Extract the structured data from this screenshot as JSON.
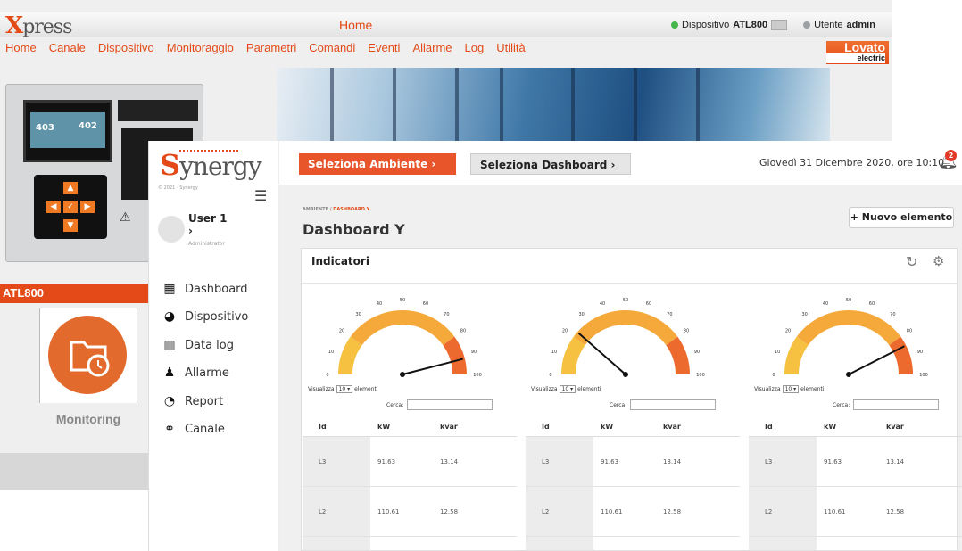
{
  "xpress": {
    "logo_x": "X",
    "logo_rest": "press",
    "page_title": "Home",
    "device_label": "Dispositivo",
    "device_name": "ATL800",
    "user_label": "Utente",
    "user_name": "admin",
    "status_color": "#45b649",
    "nav": [
      "Home",
      "Canale",
      "Dispositivo",
      "Monitoraggio",
      "Parametri",
      "Comandi",
      "Eventi",
      "Allarme",
      "Log",
      "Utilità"
    ],
    "brand": "Lovato",
    "brand_sub": "electric",
    "device_screen_left": "403",
    "device_screen_right": "402",
    "device_model": "ATL800",
    "monitoring_label": "Monitoring"
  },
  "synergy": {
    "logo_s": "S",
    "logo_rest": "ynergy",
    "copyright": "© 2021 - Synergy",
    "user": {
      "name": "User 1",
      "arrow": "›",
      "role": "Administrator"
    },
    "menu": [
      {
        "label": "Dashboard",
        "icon": "grid-icon"
      },
      {
        "label": "Dispositivo",
        "icon": "gauge-icon"
      },
      {
        "label": "Data log",
        "icon": "chart-icon"
      },
      {
        "label": "Allarme",
        "icon": "bell-icon"
      },
      {
        "label": "Report",
        "icon": "pie-icon"
      },
      {
        "label": "Canale",
        "icon": "network-icon"
      }
    ],
    "btn_ambiente": "Seleziona Ambiente  ›",
    "btn_dashboard": "Seleziona Dashboard  ›",
    "date": "Giovedì 31 Dicembre 2020, ore 10:10",
    "notifications": "2",
    "breadcrumb_root": "AMBIENTE",
    "breadcrumb_sep": " / ",
    "breadcrumb_current": "DASHBOARD Y",
    "dashboard_title": "Dashboard Y",
    "btn_new": "+ Nuovo elemento",
    "panel_title": "Indicatori",
    "accent": "#e8552b"
  },
  "gauges": [
    {
      "value": 92,
      "ticks": [
        "0",
        "10",
        "20",
        "30",
        "40",
        "50",
        "60",
        "70",
        "80",
        "90",
        "100"
      ]
    },
    {
      "value": 23,
      "ticks": [
        "0",
        "10",
        "20",
        "30",
        "40",
        "50",
        "60",
        "70",
        "80",
        "90",
        "100"
      ]
    },
    {
      "value": 85,
      "ticks": [
        "0",
        "10",
        "20",
        "30",
        "40",
        "50",
        "60",
        "70",
        "80",
        "90",
        "100"
      ]
    }
  ],
  "table": {
    "show_label": "Visualizza",
    "show_value": "10",
    "show_suffix": "elementi",
    "search_label": "Cerca:",
    "columns": [
      "Id",
      "kW",
      "kvar"
    ],
    "rows": [
      [
        "L3",
        "91.63",
        "13.14"
      ],
      [
        "L2",
        "110.61",
        "12.58"
      ]
    ]
  }
}
